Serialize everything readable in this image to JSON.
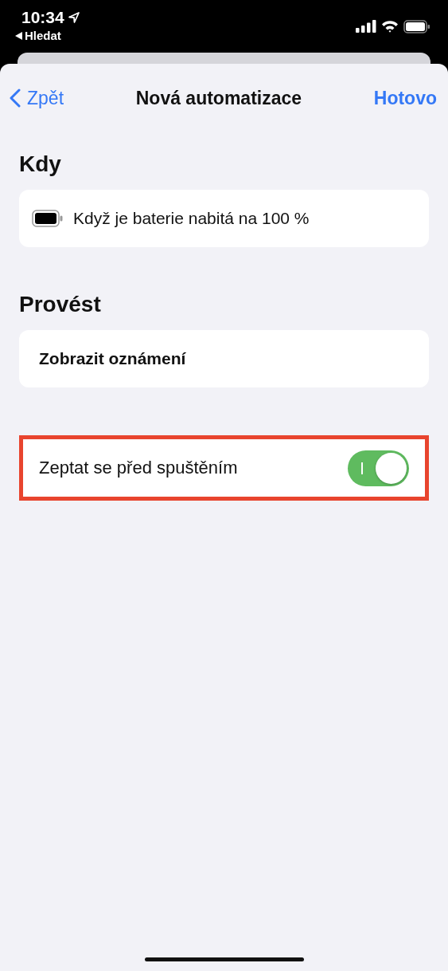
{
  "status_bar": {
    "time": "10:34",
    "back_link": "Hledat"
  },
  "nav": {
    "back": "Zpět",
    "title": "Nová automatizace",
    "done": "Hotovo"
  },
  "when": {
    "header": "Kdy",
    "trigger": "Když je baterie nabitá na 100 %"
  },
  "do": {
    "header": "Provést",
    "action": "Zobrazit oznámení"
  },
  "ask_before_running": {
    "label": "Zeptat se před spuštěním",
    "on": true,
    "highlighted": true
  }
}
